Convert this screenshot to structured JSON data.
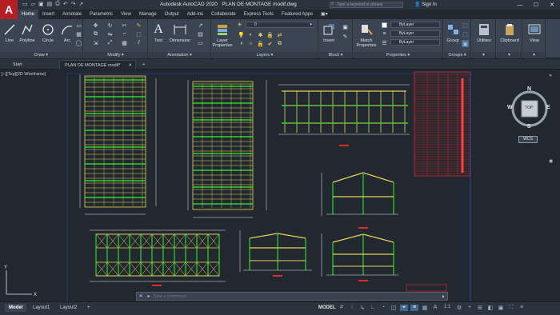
{
  "app": {
    "logo": "A",
    "title": "Autodesk AutoCAD 2020",
    "document": "PLAN DE MONTAGE modif.dwg",
    "search_placeholder": "Type a keyword or phrase",
    "signin": "Sign In"
  },
  "ribbon_tabs": [
    "Home",
    "Insert",
    "Annotate",
    "Parametric",
    "View",
    "Manage",
    "Output",
    "Add-ins",
    "Collaborate",
    "Express Tools",
    "Featured Apps"
  ],
  "draw_tools": [
    "Line",
    "Polyline",
    "Circle",
    "Arc"
  ],
  "annotation_tools": [
    "Text",
    "Dimension"
  ],
  "layer_tool": [
    "Layer",
    "Properties"
  ],
  "insert_tool": "Insert",
  "match_tool": [
    "Match",
    "Properties"
  ],
  "group_tool": "Group",
  "utilities_tool": "Utilities",
  "clipboard_tool": "Clipboard",
  "view_tool": "View",
  "layer_value": "0",
  "bylayer": [
    "ByLayer",
    "ByLayer",
    "ByLayer"
  ],
  "panel_titles": {
    "draw": "Draw",
    "modify": "Modify",
    "annotation": "Annotation",
    "layers": "Layers",
    "block": "Block",
    "properties": "Properties",
    "groups": "Groups"
  },
  "doc_tabs": [
    "Start",
    "PLAN DE MONTAGE modif*"
  ],
  "viewport_label": "[−][Top][2D Wireframe]",
  "viewcube": {
    "top": "TOP",
    "n": "N",
    "s": "S",
    "e": "E",
    "w": "W",
    "wcs": "WCS"
  },
  "command_placeholder": "Type a command",
  "layout_tabs": [
    "Model",
    "Layout1",
    "Layout2"
  ],
  "status": {
    "model": "MODEL",
    "scale": "1:1"
  },
  "colors": {
    "drawing_bg": "#212830",
    "steel": "#e5d35a",
    "green": "#2fd42a",
    "red": "#e12a2a",
    "white": "#e8e8e8"
  }
}
